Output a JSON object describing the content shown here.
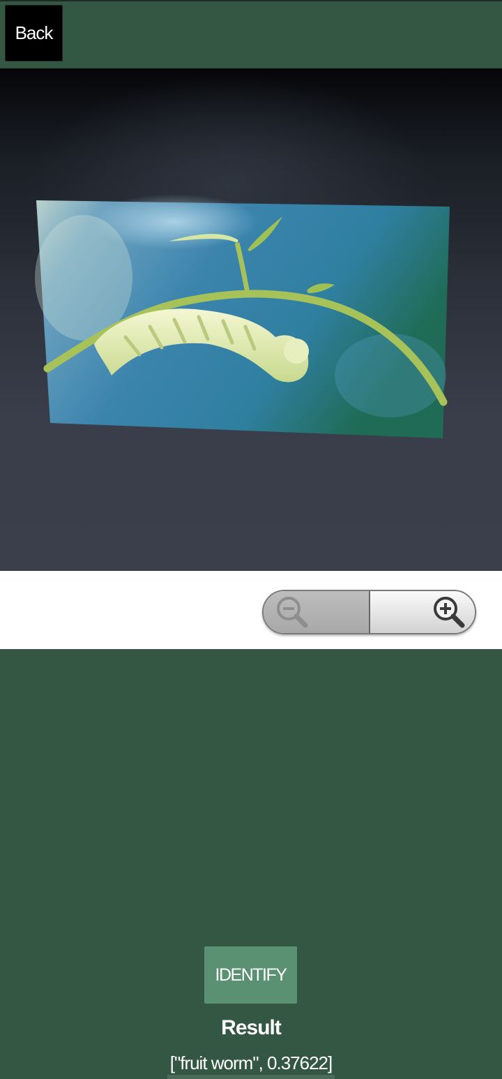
{
  "header": {
    "back_label": "Back"
  },
  "camera_preview": {
    "subject": "caterpillar on plant stem"
  },
  "zoom_control": {
    "zoom_out_icon": "zoom-out-icon",
    "zoom_in_icon": "zoom-in-icon"
  },
  "actions": {
    "identify_label": "IDENTIFY"
  },
  "result": {
    "heading": "Result",
    "value": "[\"fruit worm\", 0.37622]"
  },
  "colors": {
    "background": "#345744",
    "identify_button": "#5b9173",
    "back_button": "#000000"
  }
}
